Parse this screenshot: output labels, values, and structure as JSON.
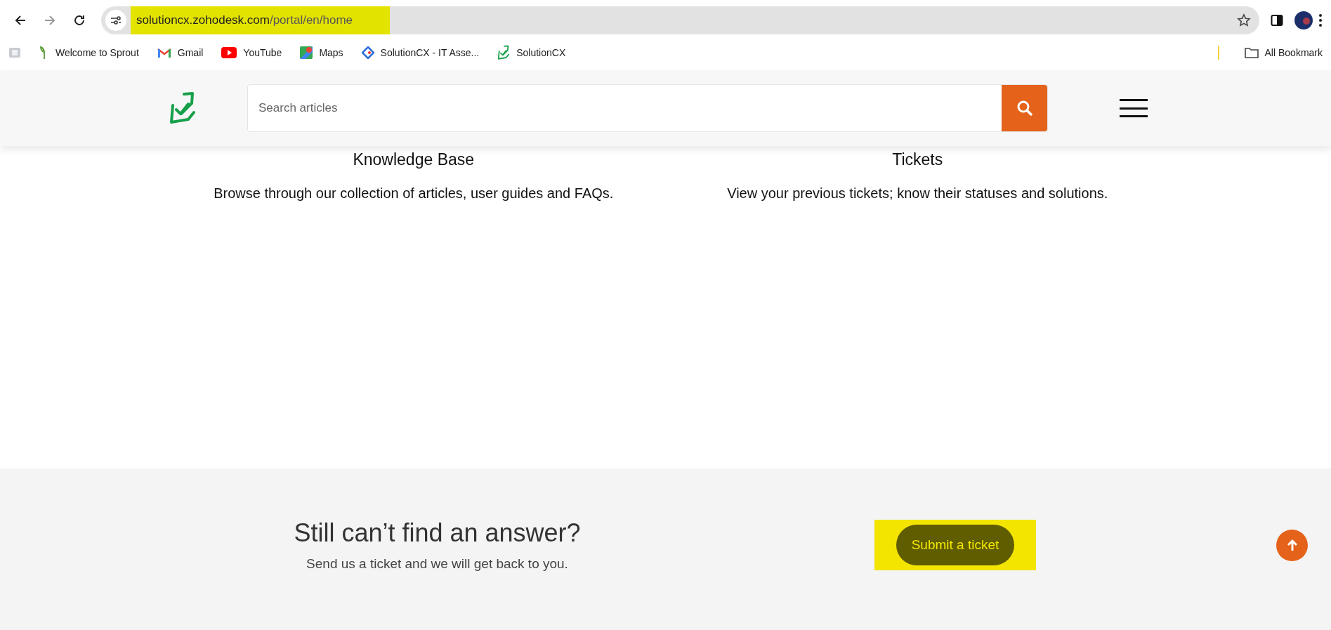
{
  "browser": {
    "address": {
      "host": "solutioncx.zohodesk.com",
      "path": "/portal/en/home",
      "highlighted": true
    },
    "bookmarks": [
      {
        "kind": "apps"
      },
      {
        "kind": "sprout",
        "label": "Welcome to Sprout"
      },
      {
        "kind": "gmail",
        "label": "Gmail"
      },
      {
        "kind": "youtube",
        "label": "YouTube"
      },
      {
        "kind": "maps",
        "label": "Maps"
      },
      {
        "kind": "diamond",
        "label": "SolutionCX - IT Asse..."
      },
      {
        "kind": "logo",
        "label": "SolutionCX"
      }
    ],
    "all_bookmarks": "All Bookmark"
  },
  "header": {
    "search": {
      "placeholder": "Search articles"
    }
  },
  "sections": [
    {
      "title": "Knowledge Base",
      "description": "Browse through our collection of articles, user guides and FAQs."
    },
    {
      "title": "Tickets",
      "description": "View your previous tickets; know their statuses and solutions."
    }
  ],
  "footer": {
    "title": "Still can’t find an answer?",
    "subtitle": "Send us a ticket and we will get back to you.",
    "button": {
      "label": "Submit a ticket",
      "highlighted": true
    }
  }
}
